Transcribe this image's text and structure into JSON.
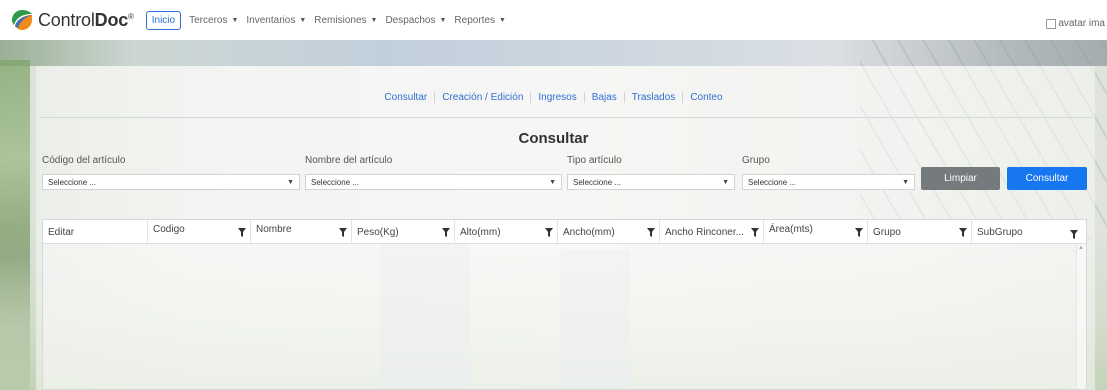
{
  "navbar": {
    "brand_prefix": "Control",
    "brand_suffix": "Doc",
    "brand_mark": "®",
    "items": [
      {
        "label": "Inicio",
        "active": true
      },
      {
        "label": "Terceros",
        "dropdown": true
      },
      {
        "label": "Inventarios",
        "dropdown": true
      },
      {
        "label": "Remisiones",
        "dropdown": true
      },
      {
        "label": "Despachos",
        "dropdown": true
      },
      {
        "label": "Reportes",
        "dropdown": true
      }
    ],
    "avatar_alt": "avatar ima"
  },
  "subnav": {
    "links": [
      "Consultar",
      "Creación / Edición",
      "Ingresos",
      "Bajas",
      "Traslados",
      "Conteo"
    ]
  },
  "form": {
    "title": "Consultar",
    "fields": [
      {
        "label": "Código del artículo",
        "value": "Seleccione ..."
      },
      {
        "label": "Nombre del artículo",
        "value": "Seleccione ..."
      },
      {
        "label": "Tipo artículo",
        "value": "Seleccione ..."
      },
      {
        "label": "Grupo",
        "value": "Seleccione ..."
      }
    ],
    "clear_label": "Limpiar",
    "submit_label": "Consultar"
  },
  "grid": {
    "columns": [
      "Editar",
      "Codigo",
      "Nombre",
      "Peso(Kg)",
      "Alto(mm)",
      "Ancho(mm)",
      "Ancho Rinconer...",
      "Área(mts)",
      "Grupo",
      "SubGrupo"
    ]
  },
  "colors": {
    "primary": "#1677f0",
    "secondary": "#757a7d",
    "link": "#2f6fd6",
    "logo_green": "#2e9a47"
  }
}
